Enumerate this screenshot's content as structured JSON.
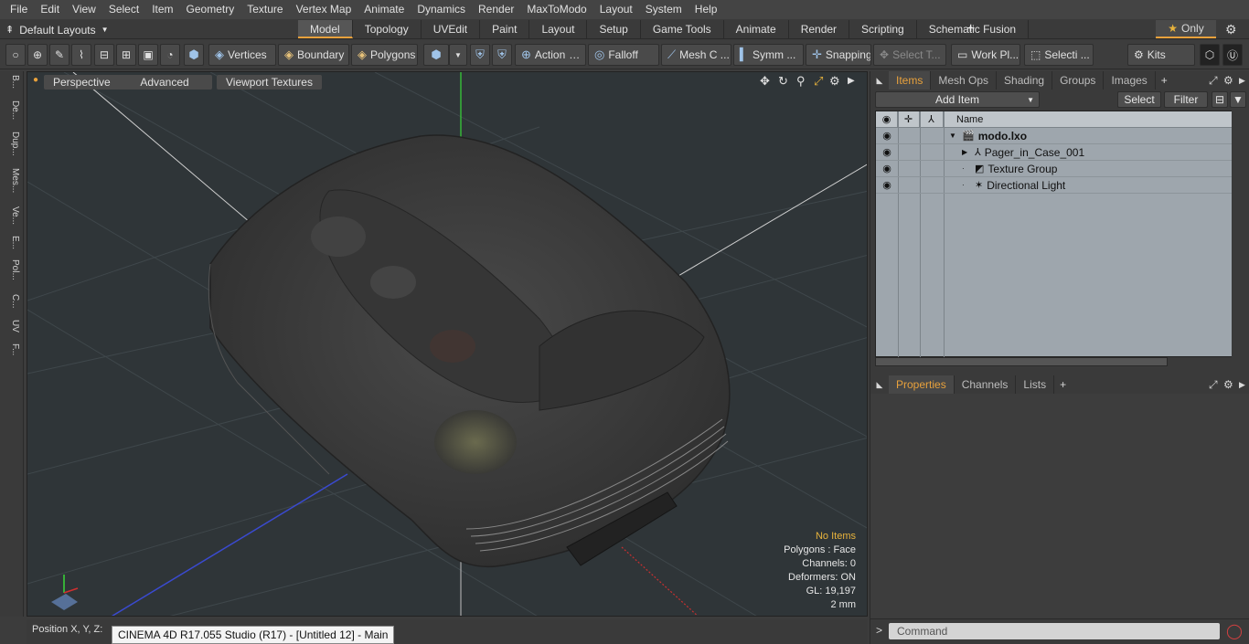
{
  "menubar": [
    "File",
    "Edit",
    "View",
    "Select",
    "Item",
    "Geometry",
    "Texture",
    "Vertex Map",
    "Animate",
    "Dynamics",
    "Render",
    "MaxToModo",
    "Layout",
    "System",
    "Help"
  ],
  "layout": {
    "selector": "Default Layouts",
    "tabs": [
      "Model",
      "Topology",
      "UVEdit",
      "Paint",
      "Layout",
      "Setup",
      "Game Tools",
      "Animate",
      "Render",
      "Scripting",
      "Schematic Fusion"
    ],
    "active_tab": "Model",
    "only_label": "Only"
  },
  "toolbar": {
    "vertices": "Vertices",
    "boundary": "Boundary",
    "polygons": "Polygons",
    "action": "Action",
    "falloff": "Falloff",
    "mesh": "Mesh C ...",
    "symm": "Symm ...",
    "snapping": "Snapping",
    "select_t": "Select T...",
    "work_pl": "Work Pl...",
    "selecti": "Selecti ...",
    "kits": "Kits"
  },
  "leftstrip": [
    "B...",
    "De...",
    "Dup...",
    "Mes...",
    "Ve...",
    "E...",
    "Pol...",
    "C...",
    "UV",
    "F..."
  ],
  "viewport": {
    "tabs": [
      "Perspective",
      "Advanced",
      "Viewport Textures"
    ],
    "info": {
      "no_items": "No Items",
      "polygons": "Polygons : Face",
      "channels": "Channels: 0",
      "deformers": "Deformers: ON",
      "gl": "GL: 19,197",
      "scale": "2 mm"
    }
  },
  "status": {
    "position": "Position X, Y, Z:",
    "tooltip": "CINEMA 4D R17.055 Studio (R17) - [Untitled 12] - Main"
  },
  "items_panel": {
    "tabs": [
      "Items",
      "Mesh Ops",
      "Shading",
      "Groups",
      "Images"
    ],
    "active_tab": "Items",
    "add_item": "Add Item",
    "select": "Select",
    "filter": "Filter",
    "col_name": "Name",
    "rows": [
      {
        "label": "modo.lxo",
        "icon": "scene-icon"
      },
      {
        "label": "Pager_in_Case_001",
        "icon": "mesh-icon"
      },
      {
        "label": "Texture Group",
        "icon": "texture-group-icon"
      },
      {
        "label": "Directional Light",
        "icon": "light-icon"
      }
    ]
  },
  "properties_panel": {
    "tabs": [
      "Properties",
      "Channels",
      "Lists"
    ],
    "active_tab": "Properties"
  },
  "command": {
    "placeholder": "Command"
  }
}
